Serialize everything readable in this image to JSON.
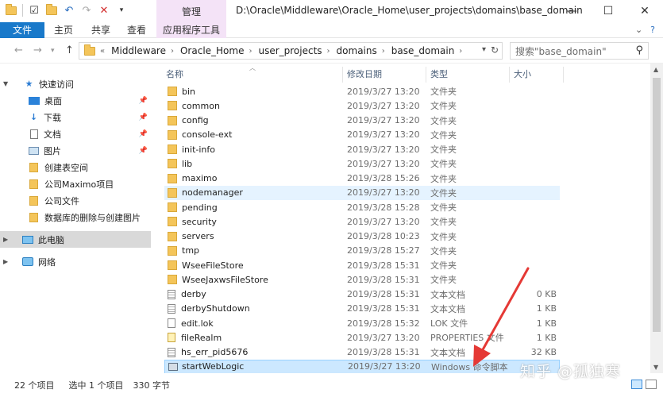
{
  "titlebar": {
    "quick_access": [
      "folder-icon",
      "properties-icon",
      "new-folder-icon",
      "undo-icon",
      "redo-icon",
      "delete-icon",
      "customize-icon"
    ],
    "context_tab": "管理",
    "path": "D:\\Oracle\\Middleware\\Oracle_Home\\user_projects\\domains\\base_domain",
    "controls": [
      "minimize-icon",
      "maximize-icon",
      "close-icon"
    ]
  },
  "ribbon": {
    "tabs": [
      "文件",
      "主页",
      "共享",
      "查看",
      "应用程序工具"
    ],
    "right_icons": [
      "chevron-down-icon",
      "help-icon"
    ]
  },
  "address": {
    "crumbs": [
      "Middleware",
      "Oracle_Home",
      "user_projects",
      "domains",
      "base_domain"
    ],
    "search_placeholder": "搜索\"base_domain\""
  },
  "nav": {
    "items": [
      {
        "label": "快速访问",
        "icon": "star-icon"
      },
      {
        "label": "桌面",
        "icon": "desktop-icon"
      },
      {
        "label": "下载",
        "icon": "download-icon"
      },
      {
        "label": "文档",
        "icon": "document-icon"
      },
      {
        "label": "图片",
        "icon": "picture-icon"
      },
      {
        "label": "创建表空间",
        "icon": "folder-icon"
      },
      {
        "label": "公司Maximo项目",
        "icon": "folder-icon"
      },
      {
        "label": "公司文件",
        "icon": "folder-icon"
      },
      {
        "label": "数据库的删除与创建图片",
        "icon": "folder-icon"
      },
      {
        "label": "此电脑",
        "icon": "computer-icon"
      },
      {
        "label": "网络",
        "icon": "network-icon"
      }
    ]
  },
  "columns": {
    "name": "名称",
    "date": "修改日期",
    "type": "类型",
    "size": "大小"
  },
  "files": [
    {
      "name": "bin",
      "date": "2019/3/27 13:20",
      "type": "文件夹",
      "size": "",
      "kind": "folder"
    },
    {
      "name": "common",
      "date": "2019/3/27 13:20",
      "type": "文件夹",
      "size": "",
      "kind": "folder"
    },
    {
      "name": "config",
      "date": "2019/3/27 13:20",
      "type": "文件夹",
      "size": "",
      "kind": "folder"
    },
    {
      "name": "console-ext",
      "date": "2019/3/27 13:20",
      "type": "文件夹",
      "size": "",
      "kind": "folder"
    },
    {
      "name": "init-info",
      "date": "2019/3/27 13:20",
      "type": "文件夹",
      "size": "",
      "kind": "folder"
    },
    {
      "name": "lib",
      "date": "2019/3/27 13:20",
      "type": "文件夹",
      "size": "",
      "kind": "folder"
    },
    {
      "name": "maximo",
      "date": "2019/3/28 15:26",
      "type": "文件夹",
      "size": "",
      "kind": "folder"
    },
    {
      "name": "nodemanager",
      "date": "2019/3/27 13:20",
      "type": "文件夹",
      "size": "",
      "kind": "folder"
    },
    {
      "name": "pending",
      "date": "2019/3/28 15:28",
      "type": "文件夹",
      "size": "",
      "kind": "folder"
    },
    {
      "name": "security",
      "date": "2019/3/27 13:20",
      "type": "文件夹",
      "size": "",
      "kind": "folder"
    },
    {
      "name": "servers",
      "date": "2019/3/28 10:23",
      "type": "文件夹",
      "size": "",
      "kind": "folder"
    },
    {
      "name": "tmp",
      "date": "2019/3/28 15:27",
      "type": "文件夹",
      "size": "",
      "kind": "folder"
    },
    {
      "name": "WseeFileStore",
      "date": "2019/3/28 15:31",
      "type": "文件夹",
      "size": "",
      "kind": "folder"
    },
    {
      "name": "WseeJaxwsFileStore",
      "date": "2019/3/28 15:31",
      "type": "文件夹",
      "size": "",
      "kind": "folder"
    },
    {
      "name": "derby",
      "date": "2019/3/28 15:31",
      "type": "文本文档",
      "size": "0 KB",
      "kind": "text"
    },
    {
      "name": "derbyShutdown",
      "date": "2019/3/28 15:31",
      "type": "文本文档",
      "size": "1 KB",
      "kind": "text"
    },
    {
      "name": "edit.lok",
      "date": "2019/3/28 15:32",
      "type": "LOK 文件",
      "size": "1 KB",
      "kind": "blank"
    },
    {
      "name": "fileRealm",
      "date": "2019/3/27 13:20",
      "type": "PROPERTIES 文件",
      "size": "1 KB",
      "kind": "realm"
    },
    {
      "name": "hs_err_pid5676",
      "date": "2019/3/28 15:31",
      "type": "文本文档",
      "size": "32 KB",
      "kind": "text"
    },
    {
      "name": "startWebLogic",
      "date": "2019/3/27 13:20",
      "type": "Windows 命令脚本",
      "size": "",
      "kind": "cmd"
    }
  ],
  "status": {
    "count": "22 个项目",
    "selected": "选中 1 个项目",
    "size": "330 字节"
  },
  "watermark": "知乎 @孤独寒",
  "colors": {
    "accent": "#1979ca",
    "context_tab": "#f4e3f7",
    "selection": "#cce8ff",
    "hover": "#e5f3ff",
    "arrow": "#e53935"
  }
}
